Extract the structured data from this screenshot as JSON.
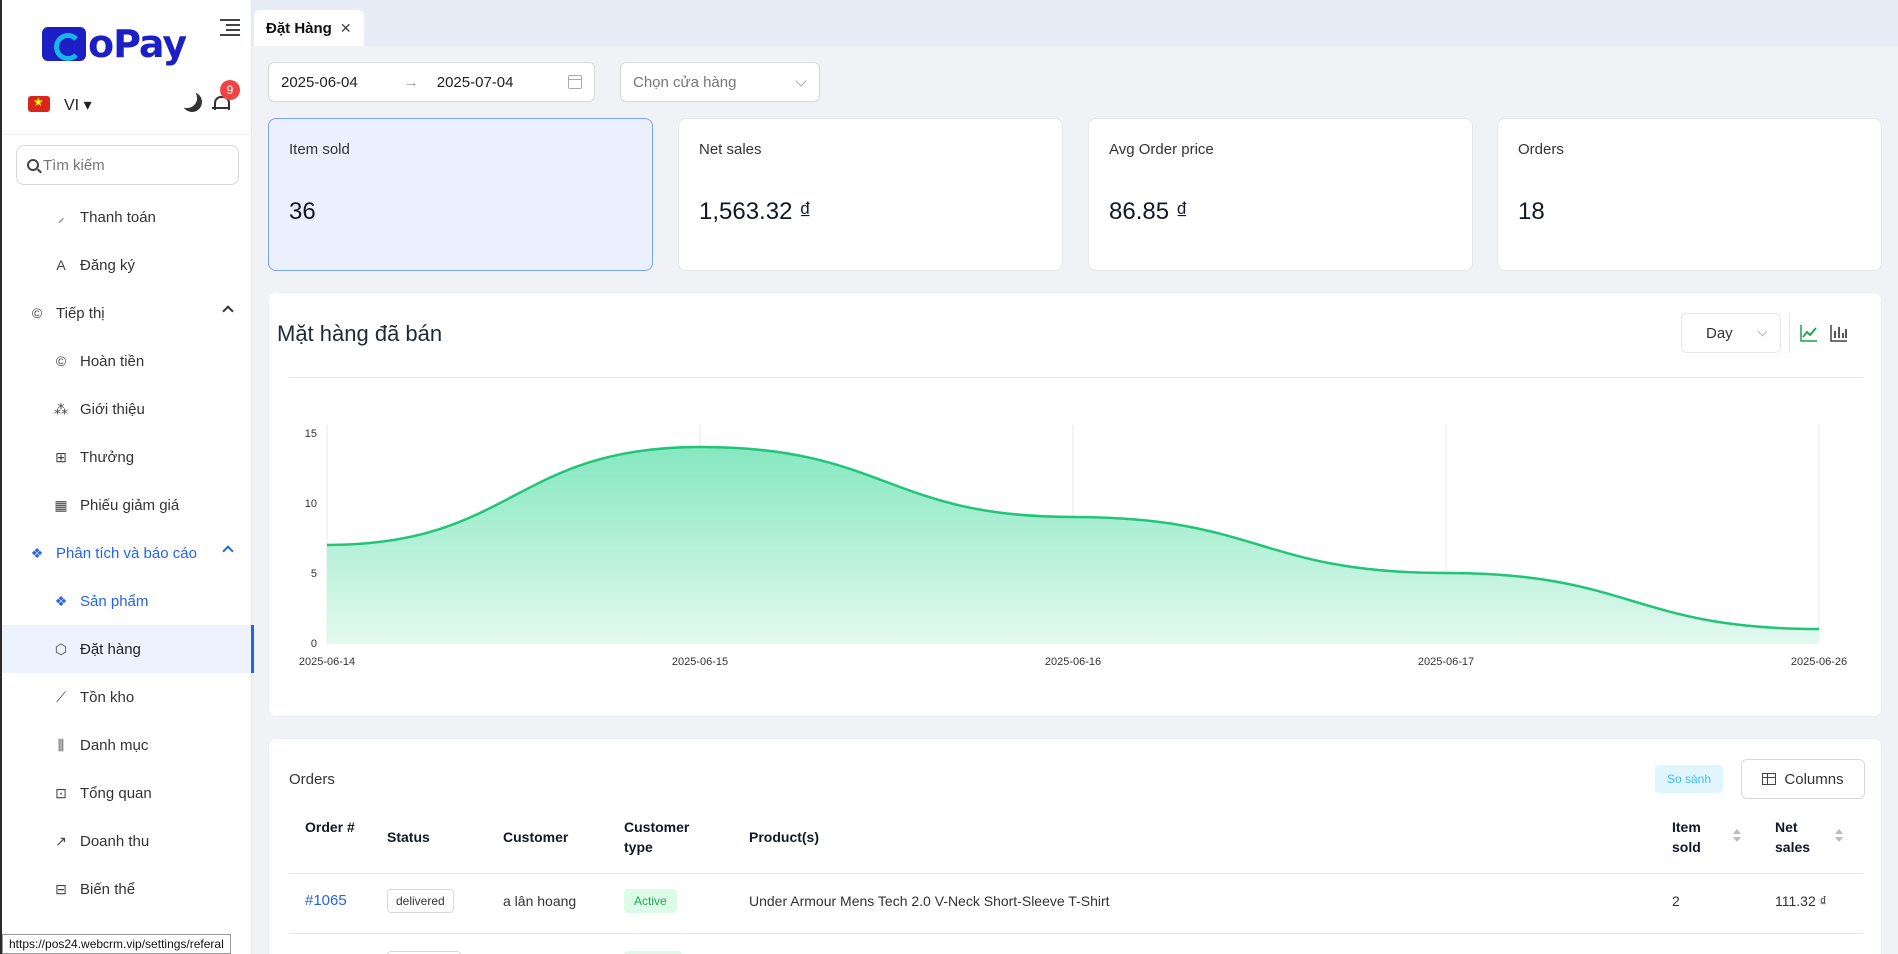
{
  "app": {
    "logo_text": "oPay",
    "language": "VI",
    "notification_count": "9",
    "search_placeholder": "Tìm kiếm",
    "status_url": "https://pos24.webcrm.vip/settings/referal"
  },
  "sidebar": {
    "items": [
      {
        "label": "Thanh toán",
        "icon": "payment-icon",
        "type": "sub"
      },
      {
        "label": "Đăng ký",
        "icon": "register-icon",
        "type": "sub"
      },
      {
        "label": "Tiếp thị",
        "icon": "copyright-circle-icon",
        "type": "group"
      },
      {
        "label": "Hoàn tiền",
        "icon": "refund-icon",
        "type": "sub"
      },
      {
        "label": "Giới thiệu",
        "icon": "referral-icon",
        "type": "sub"
      },
      {
        "label": "Thưởng",
        "icon": "gift-icon",
        "type": "sub"
      },
      {
        "label": "Phiếu giảm giá",
        "icon": "calendar-icon",
        "type": "sub"
      },
      {
        "label": "Phân tích và báo cáo",
        "icon": "dropbox-icon",
        "type": "group-active"
      },
      {
        "label": "Sản phẩm",
        "icon": "dropbox-icon",
        "type": "sub-active"
      },
      {
        "label": "Đặt hàng",
        "icon": "order-icon",
        "type": "sub-selected"
      },
      {
        "label": "Tồn kho",
        "icon": "stock-line-icon",
        "type": "sub"
      },
      {
        "label": "Danh mục",
        "icon": "category-icon",
        "type": "sub"
      },
      {
        "label": "Tổng quan",
        "icon": "overview-icon",
        "type": "sub"
      },
      {
        "label": "Doanh thu",
        "icon": "revenue-line-icon",
        "type": "sub"
      },
      {
        "label": "Biến thể",
        "icon": "variant-icon",
        "type": "sub"
      }
    ]
  },
  "tabs": [
    {
      "label": "Đặt Hàng"
    }
  ],
  "filters": {
    "date_from": "2025-06-04",
    "date_to": "2025-07-04",
    "store_placeholder": "Chọn cửa hàng"
  },
  "stats": [
    {
      "label": "Item sold",
      "value": "36"
    },
    {
      "label": "Net sales",
      "value": "1,563.32 ₫"
    },
    {
      "label": "Avg Order price",
      "value": "86.85 ₫"
    },
    {
      "label": "Orders",
      "value": "18"
    }
  ],
  "chart_card": {
    "title": "Mặt hàng đã bán",
    "interval": "Day"
  },
  "chart_data": {
    "type": "area",
    "categories": [
      "2025-06-14",
      "2025-06-15",
      "2025-06-16",
      "2025-06-17",
      "2025-06-26"
    ],
    "values": [
      7,
      14,
      9,
      5,
      1
    ],
    "yticks": [
      "0",
      "5",
      "10",
      "15"
    ],
    "ylim": [
      0,
      15
    ],
    "grid": "vertical",
    "colors": {
      "line": "#22c47a",
      "fill_top": "#86e8c0",
      "fill_bottom": "#e3f9ef"
    }
  },
  "orders": {
    "title": "Orders",
    "compare_label": "So sánh",
    "columns_label": "Columns",
    "headers": {
      "order": "Order #",
      "status": "Status",
      "customer": "Customer",
      "customer_type": "Customer type",
      "products": "Product(s)",
      "item_sold": "Item sold",
      "net_sales": "Net sales"
    },
    "rows": [
      {
        "order": "#1065",
        "status": "delivered",
        "customer": "a lân hoang",
        "customer_type": "Active",
        "products": "Under Armour Mens Tech 2.0 V-Neck Short-Sleeve T-Shirt",
        "item_sold": "2",
        "net_sales": "111.32 ₫"
      }
    ]
  }
}
